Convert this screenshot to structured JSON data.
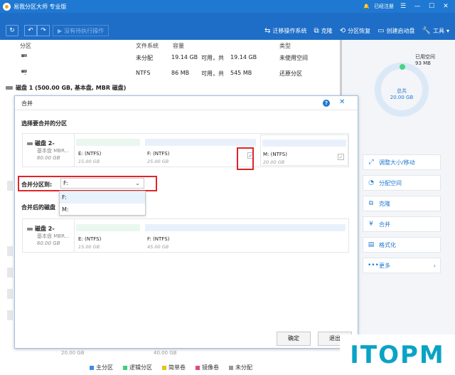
{
  "app": {
    "title": "易我分区大师 专业版",
    "account": "已经注册"
  },
  "toolbar": {
    "pending": "没有待执行操作",
    "tools": [
      {
        "icon": "migrate-icon",
        "label": "迁移操作系统"
      },
      {
        "icon": "clone-icon",
        "label": "克隆"
      },
      {
        "icon": "recovery-icon",
        "label": "分区恢复"
      },
      {
        "icon": "bootdisk-icon",
        "label": "创建启动盘"
      },
      {
        "icon": "wrench-icon",
        "label": "工具"
      }
    ]
  },
  "table": {
    "headers": [
      "分区",
      "文件系统",
      "容量",
      "类型"
    ],
    "rows": [
      {
        "name": "*",
        "fs": "未分配",
        "used": "19.14 GB",
        "free_prefix": "可用，共",
        "total": "19.14 GB",
        "type": "未使用空间"
      },
      {
        "name": "*:",
        "fs": "NTFS",
        "used": "86 MB",
        "free_prefix": "可用，共",
        "total": "545 MB",
        "type": "还原分区"
      }
    ],
    "disk1": "磁盘 1 (500.00 GB, 基本盘, MBR 磁盘)",
    "bottom_vals": [
      "20.00 GB",
      "40.00 GB"
    ]
  },
  "ring": {
    "used_label": "已用空间",
    "used_value": "93 MB",
    "total_label": "总共",
    "total_value": "20.00 GB"
  },
  "operations": [
    {
      "icon": "resize-icon",
      "label": "调整大小/移动"
    },
    {
      "icon": "allocate-icon",
      "label": "分配空间"
    },
    {
      "icon": "clone-icon",
      "label": "克隆"
    },
    {
      "icon": "merge-icon",
      "label": "合并"
    },
    {
      "icon": "format-icon",
      "label": "格式化"
    },
    {
      "icon": "more-icon",
      "label": "更多"
    }
  ],
  "legend": [
    {
      "label": "主分区",
      "color": "#3b8ee8"
    },
    {
      "label": "逻辑分区",
      "color": "#3fcf7c"
    },
    {
      "label": "简单卷",
      "color": "#e8c21c"
    },
    {
      "label": "镜像卷",
      "color": "#e04c7c"
    },
    {
      "label": "未分配",
      "color": "#999999"
    }
  ],
  "dialog": {
    "title": "合并",
    "select_title": "选择要合并的分区",
    "disk_name": "磁盘 2-",
    "disk_type": "基本盘 MBR...",
    "disk_size": "60.00 GB",
    "partitions": [
      {
        "label": "E: (NTFS)",
        "size": "15.00 GB"
      },
      {
        "label": "F: (NTFS)",
        "size": "25.00 GB"
      },
      {
        "label": "M: (NTFS)",
        "size": "20.00 GB"
      }
    ],
    "checkbox_mark": "✓",
    "merge_to_label": "合并分区到:",
    "merge_to_value": "F:",
    "options": [
      "F:",
      "M:"
    ],
    "after_title": "合并后的磁盘",
    "after_partitions": [
      {
        "label": "E: (NTFS)",
        "size": "15.00 GB"
      },
      {
        "label": "F: (NTFS)",
        "size": "45.00 GB"
      }
    ],
    "ok": "确定",
    "cancel": "退出"
  },
  "watermark": "ITOPM"
}
